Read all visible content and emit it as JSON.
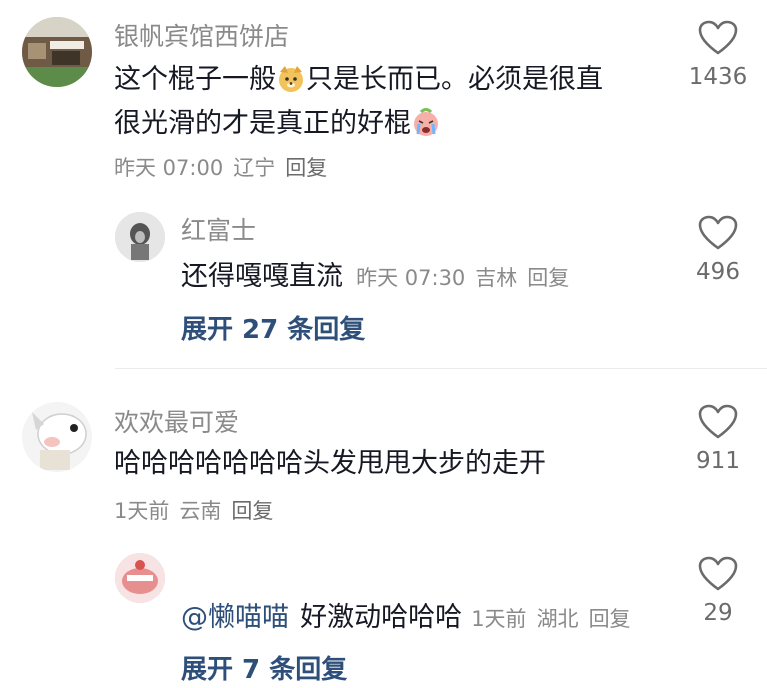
{
  "comments": [
    {
      "username": "银帆宾馆西饼店",
      "text_part1": "这个棍子一般",
      "text_part2": "只是长而已。必须是很直",
      "text_part3": "很光滑的才是真正的好棍",
      "time": "昨天 07:00",
      "location": "辽宁",
      "reply_label": "回复",
      "likes": "1436",
      "replies": [
        {
          "username": "红富士",
          "text": "还得嘎嘎直流",
          "time": "昨天 07:30",
          "location": "吉林",
          "reply_label": "回复",
          "likes": "496"
        }
      ],
      "expand_label": "展开 27 条回复"
    },
    {
      "username": "欢欢最可爱",
      "text": "哈哈哈哈哈哈哈头发甩甩大步的走开",
      "time": "1天前",
      "location": "云南",
      "reply_label": "回复",
      "likes": "911",
      "replies": [
        {
          "mention": "@懒喵喵",
          "text": "好激动哈哈哈",
          "time": "1天前",
          "location": "湖北",
          "reply_label": "回复",
          "likes": "29"
        }
      ],
      "expand_label": "展开 7 条回复"
    }
  ],
  "icons": {
    "like": "heart-outline-icon",
    "emoji_1": "dog-face-emoji",
    "emoji_2": "crying-face-emoji"
  },
  "colors": {
    "primary_text": "#161823",
    "secondary_text": "#8a8a8a",
    "link": "#2e4f7a"
  }
}
